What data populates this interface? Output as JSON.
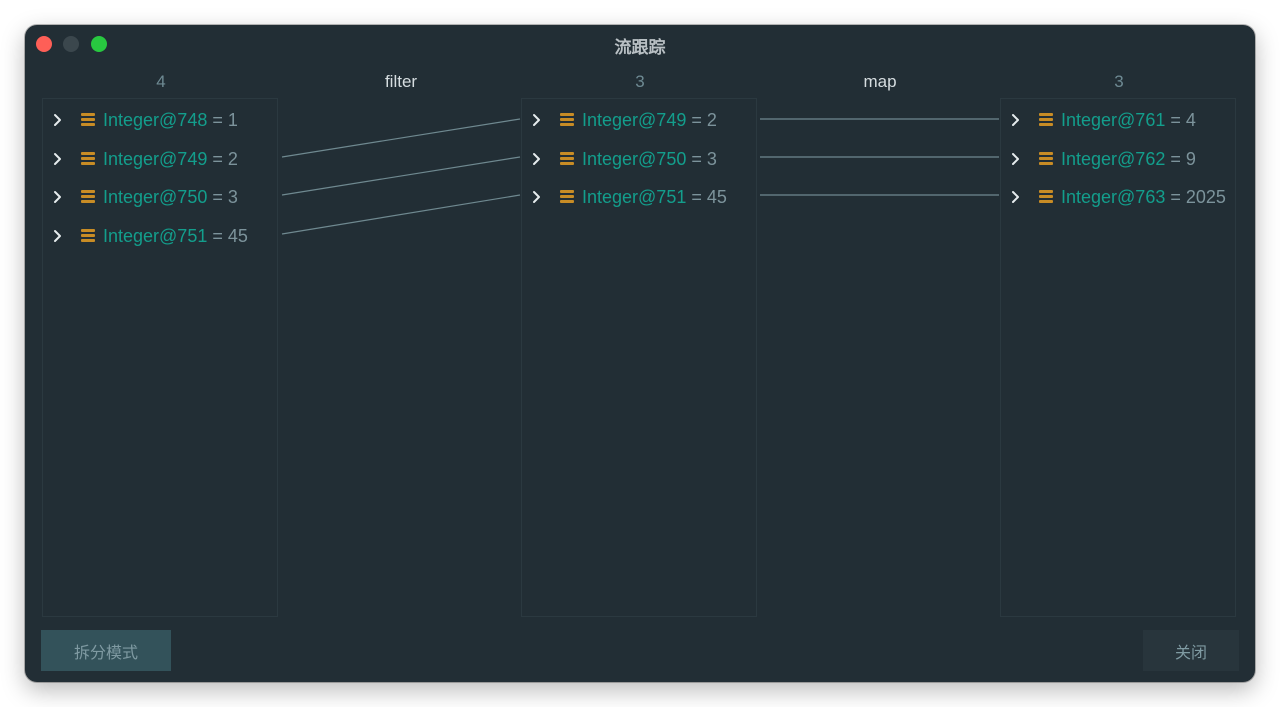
{
  "window": {
    "title": "流跟踪",
    "buttons": {
      "split_mode": "拆分模式",
      "close": "关闭"
    }
  },
  "headers": {
    "col1_count": "4",
    "op1": "filter",
    "col2_count": "3",
    "op2": "map",
    "col3_count": "3"
  },
  "columns": [
    {
      "rows": [
        {
          "obj": "Integer@748",
          "val": " = 1"
        },
        {
          "obj": "Integer@749",
          "val": " = 2"
        },
        {
          "obj": "Integer@750",
          "val": " = 3"
        },
        {
          "obj": "Integer@751",
          "val": " = 45"
        }
      ]
    },
    {
      "rows": [
        {
          "obj": "Integer@749",
          "val": " = 2"
        },
        {
          "obj": "Integer@750",
          "val": " = 3"
        },
        {
          "obj": "Integer@751",
          "val": " = 45"
        }
      ]
    },
    {
      "rows": [
        {
          "obj": "Integer@761",
          "val": " = 4"
        },
        {
          "obj": "Integer@762",
          "val": " = 9"
        },
        {
          "obj": "Integer@763",
          "val": " = 2025"
        }
      ]
    }
  ],
  "icons": {
    "expand": "chevron-right-icon",
    "object": "object-icon",
    "object_color": "#c88c25",
    "object_name_color": "#139e8c",
    "value_color": "#7c939b",
    "link_color": "#6f8990"
  }
}
